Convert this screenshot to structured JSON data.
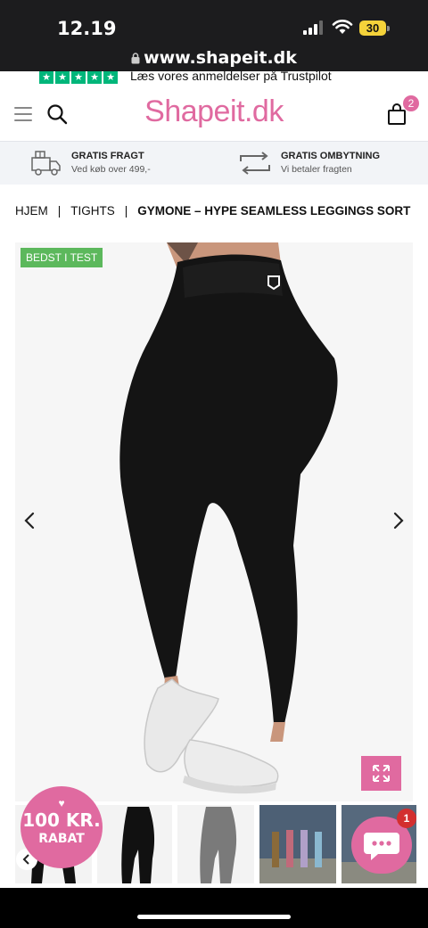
{
  "status_bar": {
    "time": "12.19",
    "battery": "30"
  },
  "browser": {
    "url": "www.shapeit.dk"
  },
  "trustpilot": {
    "text": "Læs vores anmeldelser på Trustpilot",
    "star_color": "#00b67a"
  },
  "header": {
    "logo": "Shapeit.dk",
    "cart_count": "2",
    "accent": "#e06aa0"
  },
  "usp": [
    {
      "title": "GRATIS FRAGT",
      "subtitle": "Ved køb over 499,-"
    },
    {
      "title": "GRATIS OMBYTNING",
      "subtitle": "Vi betaler fragten"
    }
  ],
  "breadcrumb": {
    "home": "HJEM",
    "category": "TIGHTS",
    "current": "GYMONE – HYPE SEAMLESS LEGGINGS SORT"
  },
  "gallery": {
    "badge": "BEDST I TEST"
  },
  "promo": {
    "heart": "♥",
    "line1": "100 KR.",
    "line2": "RABAT"
  },
  "chat": {
    "unread": "1"
  }
}
